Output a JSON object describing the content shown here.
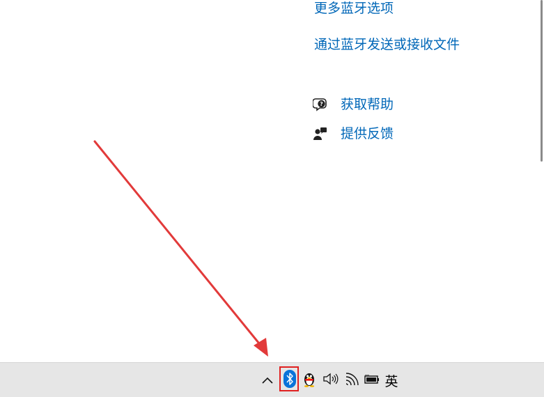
{
  "settings": {
    "links": {
      "more_bluetooth_options": "更多蓝牙选项",
      "send_receive_files": "通过蓝牙发送或接收文件"
    },
    "help": {
      "get_help": "获取帮助",
      "give_feedback": "提供反馈"
    }
  },
  "taskbar": {
    "tray": {
      "show_hidden_icon": "chevron-up-icon",
      "bluetooth_icon": "bluetooth-icon",
      "qq_icon": "qq-penguin-icon",
      "volume_icon": "speaker-icon",
      "network_icon": "wifi-icon",
      "battery_icon": "battery-icon",
      "input_method": "英"
    }
  },
  "colors": {
    "link": "#0067b8",
    "taskbar_bg": "#e6e6e6",
    "annotation_red": "#e02020",
    "bluetooth_blue": "#0a73d9"
  }
}
